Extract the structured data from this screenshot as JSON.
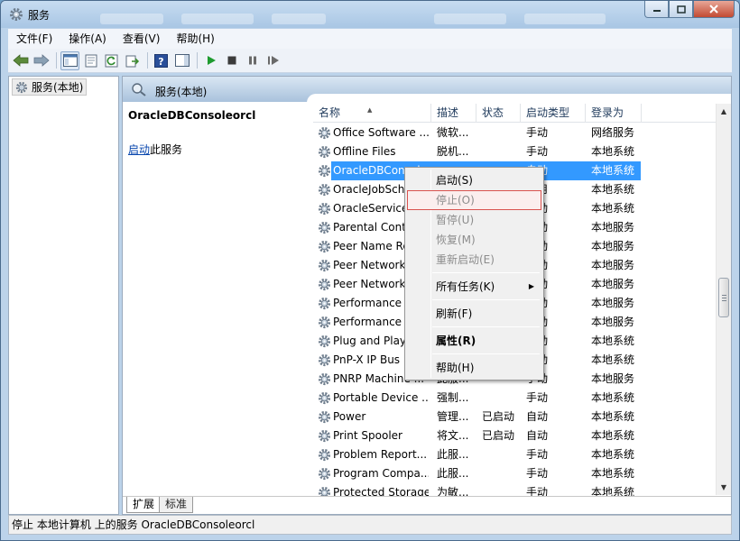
{
  "window": {
    "title": "服务",
    "controls": [
      "0",
      "1",
      "r"
    ]
  },
  "menubar": [
    {
      "label": "文件(F)"
    },
    {
      "label": "操作(A)"
    },
    {
      "label": "查看(V)"
    },
    {
      "label": "帮助(H)"
    }
  ],
  "left_pane": {
    "tree_item": "服务(本地)"
  },
  "right_pane": {
    "header": "服务(本地)",
    "extended": {
      "service_name": "OracleDBConsoleorcl",
      "start_link": "启动",
      "start_suffix": "此服务"
    },
    "columns": [
      {
        "label": "名称"
      },
      {
        "label": "描述"
      },
      {
        "label": "状态"
      },
      {
        "label": "启动类型"
      },
      {
        "label": "登录为"
      }
    ],
    "rows": [
      {
        "name": "Office Software ...",
        "desc": "微软...",
        "status": "",
        "startup": "手动",
        "logon": "网络服务"
      },
      {
        "name": "Offline Files",
        "desc": "脱机...",
        "status": "",
        "startup": "手动",
        "logon": "本地系统"
      },
      {
        "name": "OracleDBConsoleorcl",
        "desc": "",
        "status": "",
        "startup": "自动",
        "logon": "本地系统"
      },
      {
        "name": "OracleJobSchedulerORCL",
        "desc": "",
        "status": "",
        "startup": "禁用",
        "logon": "本地系统"
      },
      {
        "name": "OracleServiceORCL",
        "desc": "",
        "status": "",
        "startup": "自动",
        "logon": "本地系统"
      },
      {
        "name": "Parental Controls",
        "desc": "",
        "status": "",
        "startup": "手动",
        "logon": "本地服务"
      },
      {
        "name": "Peer Name Resolution",
        "desc": "",
        "status": "",
        "startup": "手动",
        "logon": "本地服务"
      },
      {
        "name": "Peer Networking",
        "desc": "",
        "status": "",
        "startup": "手动",
        "logon": "本地服务"
      },
      {
        "name": "Peer Networking",
        "desc": "",
        "status": "",
        "startup": "手动",
        "logon": "本地服务"
      },
      {
        "name": "Performance",
        "desc": "",
        "status": "",
        "startup": "手动",
        "logon": "本地服务"
      },
      {
        "name": "Performance",
        "desc": "",
        "status": "",
        "startup": "手动",
        "logon": "本地服务"
      },
      {
        "name": "Plug and Play",
        "desc": "",
        "status": "",
        "startup": "自动",
        "logon": "本地系统"
      },
      {
        "name": "PnP-X IP Bus",
        "desc": "",
        "status": "",
        "startup": "手动",
        "logon": "本地系统"
      },
      {
        "name": "PNRP Machine ...",
        "desc": "此服...",
        "status": "",
        "startup": "手动",
        "logon": "本地服务"
      },
      {
        "name": "Portable Device ...",
        "desc": "强制...",
        "status": "",
        "startup": "手动",
        "logon": "本地系统"
      },
      {
        "name": "Power",
        "desc": "管理...",
        "status": "已启动",
        "startup": "自动",
        "logon": "本地系统"
      },
      {
        "name": "Print Spooler",
        "desc": "将文...",
        "status": "已启动",
        "startup": "自动",
        "logon": "本地系统"
      },
      {
        "name": "Problem Report...",
        "desc": "此服...",
        "status": "",
        "startup": "手动",
        "logon": "本地系统"
      },
      {
        "name": "Program Compa...",
        "desc": "此服...",
        "status": "",
        "startup": "手动",
        "logon": "本地系统"
      },
      {
        "name": "Protected Storage",
        "desc": "为敏...",
        "status": "",
        "startup": "手动",
        "logon": "本地系统"
      }
    ],
    "tabs": [
      {
        "label": "扩展"
      },
      {
        "label": "标准"
      }
    ]
  },
  "context_menu": {
    "items": [
      {
        "label": "启动(S)",
        "disabled": false
      },
      {
        "label": "停止(O)",
        "disabled": true
      },
      {
        "label": "暂停(U)",
        "disabled": true
      },
      {
        "label": "恢复(M)",
        "disabled": true
      },
      {
        "label": "重新启动(E)",
        "disabled": true
      },
      {
        "label": "所有任务(K)",
        "disabled": false,
        "submenu": "▶"
      },
      {
        "label": "刷新(F)",
        "disabled": false
      },
      {
        "label": "属性(R)",
        "disabled": false,
        "bold": true
      },
      {
        "label": "帮助(H)",
        "disabled": false
      }
    ]
  },
  "statusbar": {
    "text": "停止 本地计算机 上的服务 OracleDBConsoleorcl"
  },
  "colors": {
    "selection": "#3399ff",
    "title_gradient_top": "#c7dcf1",
    "hover_border": "#d9534f",
    "link": "#0645ad"
  },
  "icons": {
    "title": "gear-icon",
    "back": "back-arrow-icon",
    "forward": "forward-arrow-icon",
    "start": "play-icon",
    "stop": "stop-icon",
    "pause": "pause-icon",
    "restart": "restart-icon"
  }
}
